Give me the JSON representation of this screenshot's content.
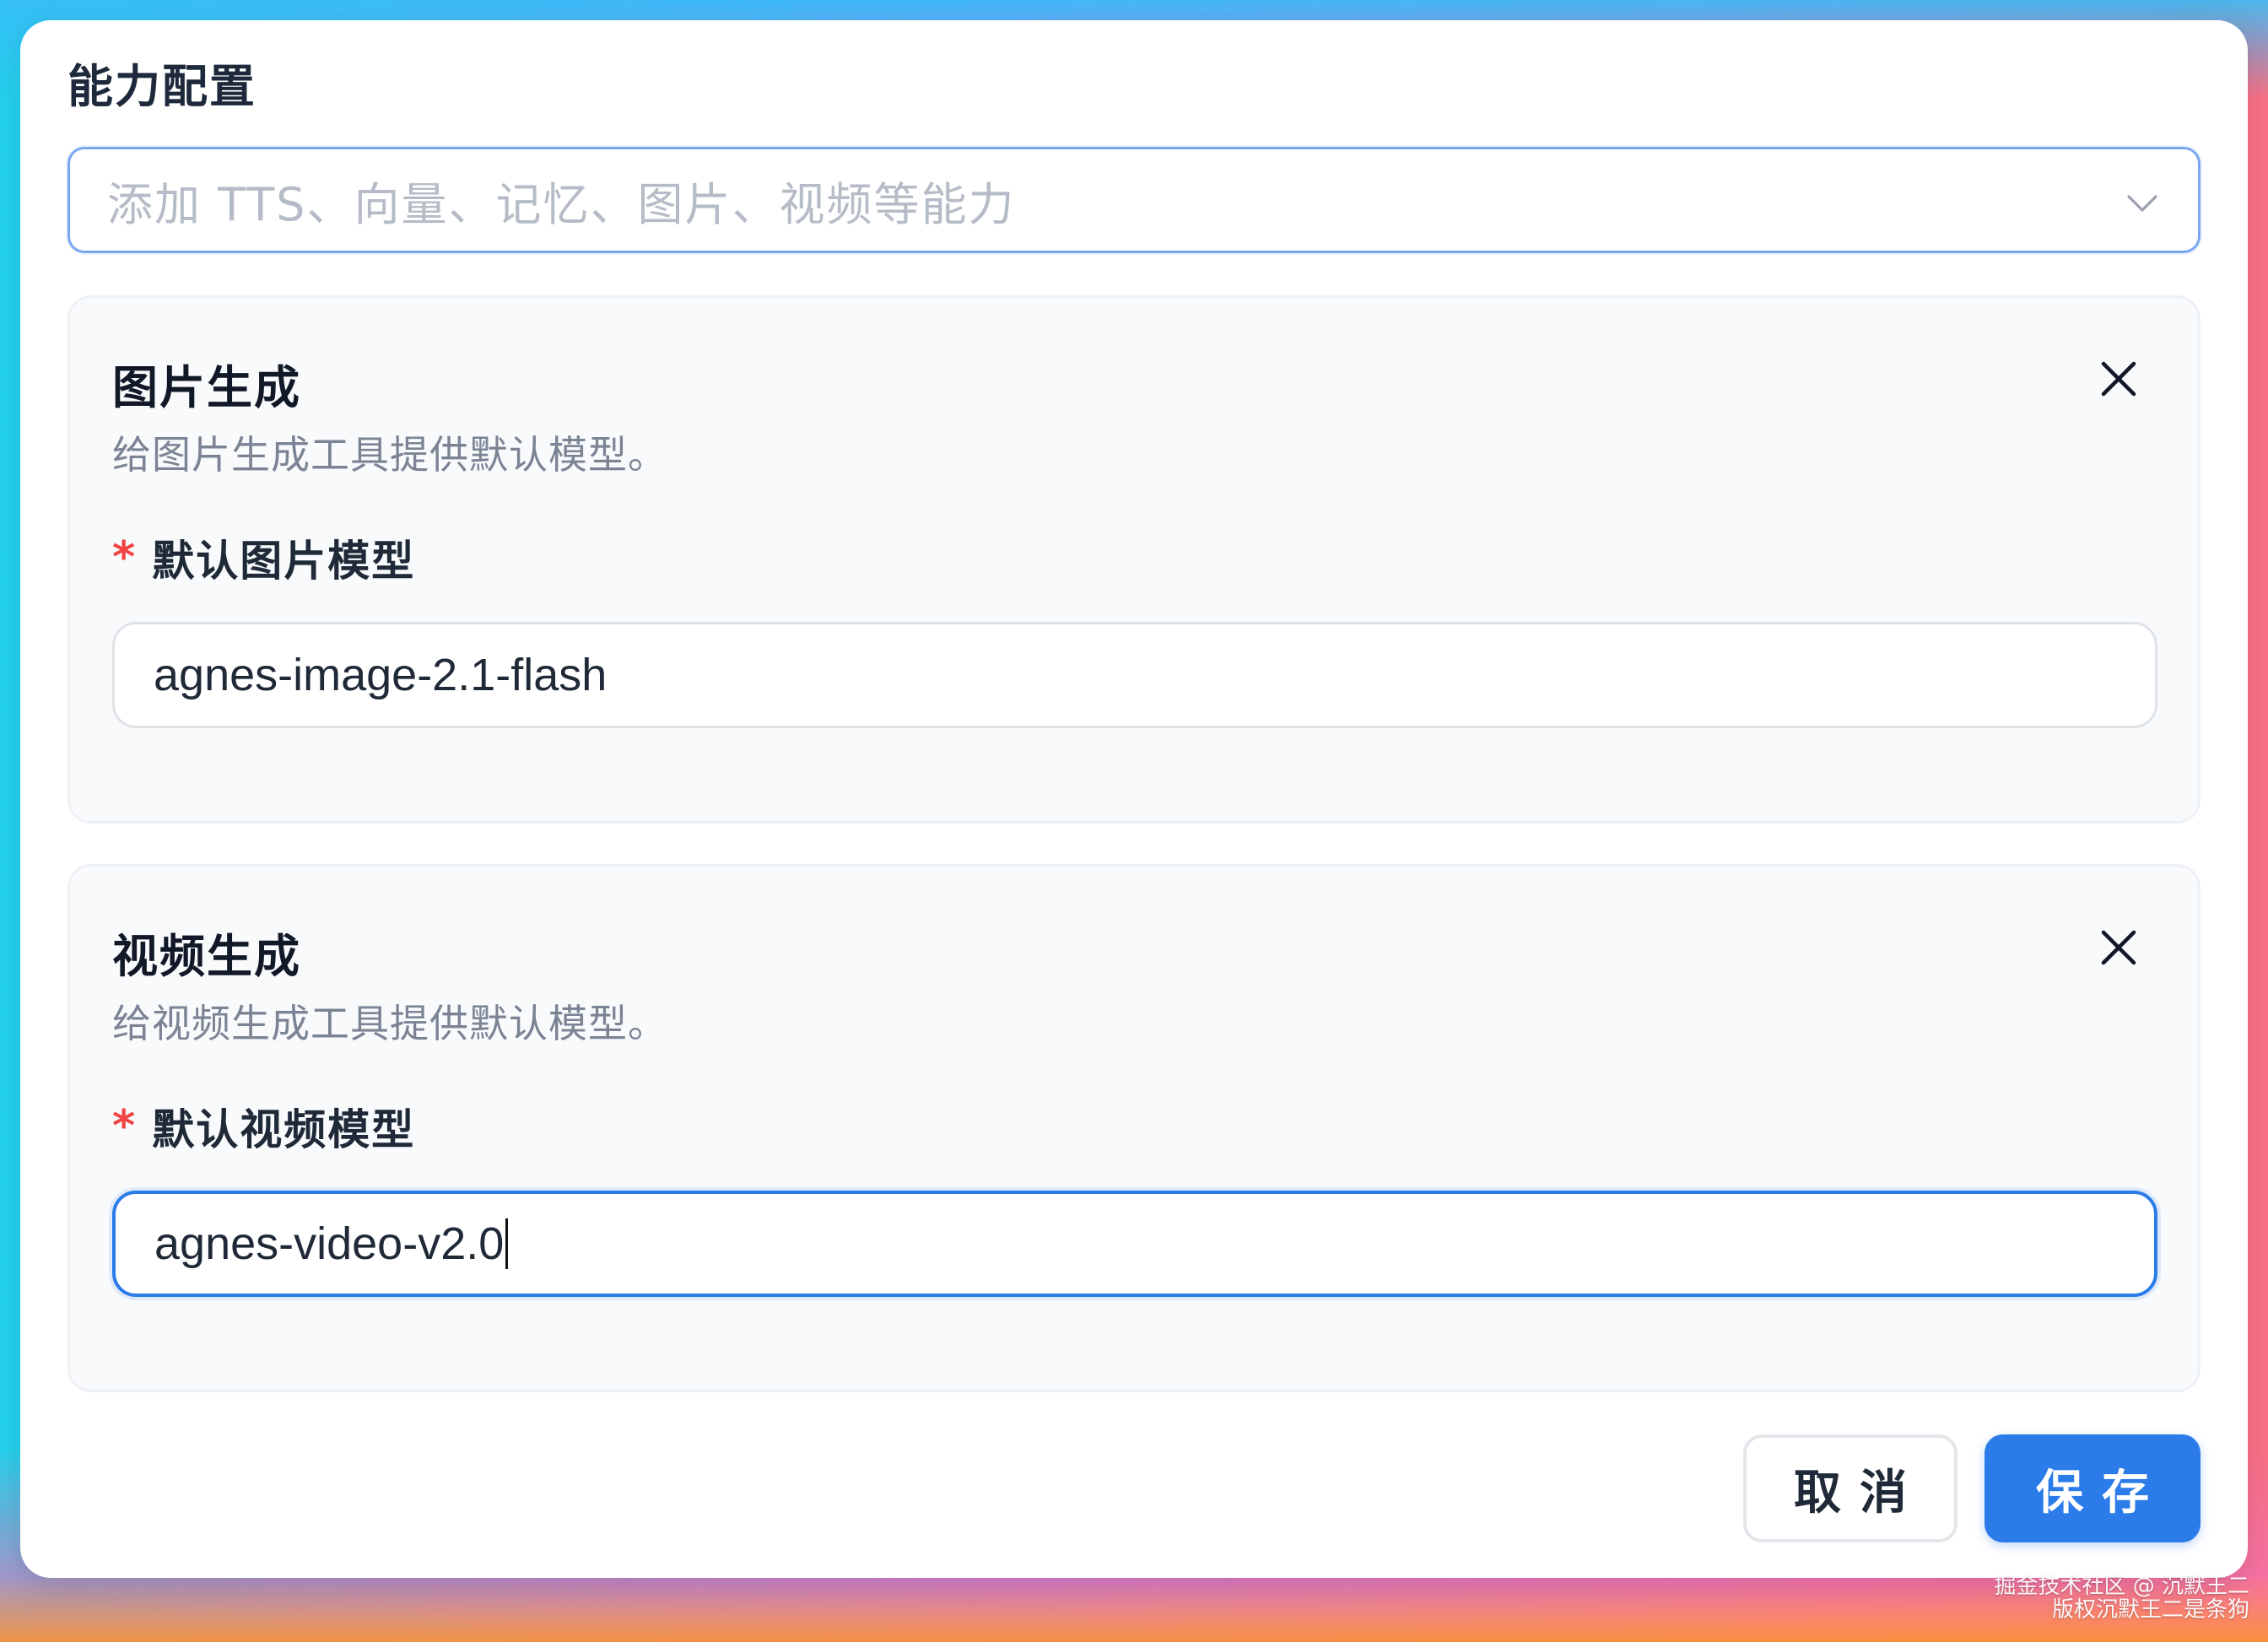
{
  "dialog": {
    "section_title": "能力配置",
    "add_capability": {
      "placeholder": "添加 TTS、向量、记忆、图片、视频等能力"
    }
  },
  "cards": {
    "image": {
      "title": "图片生成",
      "description": "给图片生成工具提供默认模型。",
      "field_required_mark": "*",
      "field_label": "默认图片模型",
      "field_value": "agnes-image-2.1-flash"
    },
    "video": {
      "title": "视频生成",
      "description": "给视频生成工具提供默认模型。",
      "field_required_mark": "*",
      "field_label": "默认视频模型",
      "field_value": "agnes-video-v2.0"
    }
  },
  "footer": {
    "cancel_label": "取消",
    "save_label": "保存"
  },
  "watermark": {
    "line1": "掘金技术社区 @ 沉默王二",
    "line2": "版权沉默王二是条狗"
  },
  "colors": {
    "accent": "#2b7be8",
    "required": "#ef4444",
    "select_border": "#7aa6f2"
  },
  "icons": {
    "chevron": "chevron-down-icon",
    "close": "close-icon"
  }
}
